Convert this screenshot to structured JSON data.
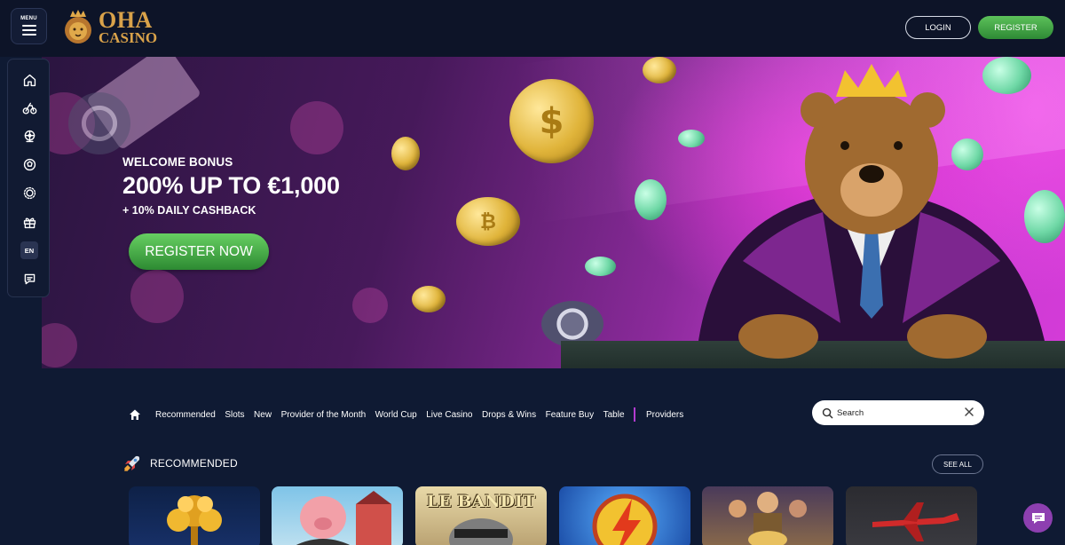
{
  "header": {
    "menu_label": "MENU",
    "logo_line1": "OHA",
    "logo_line2": "CASINO",
    "login_label": "LOGIN",
    "register_label": "REGISTER"
  },
  "sidebar": {
    "items": [
      "home-icon",
      "cycling-icon",
      "ferris-wheel-icon",
      "football-icon",
      "sun-icon",
      "gift-icon"
    ],
    "language": "EN",
    "support_icon": "chat-icon"
  },
  "banner": {
    "subtitle": "WELCOME BONUS",
    "title": "200% UP TO €1,000",
    "extra": "+ 10% DAILY CASHBACK",
    "cta_label": "REGISTER NOW"
  },
  "nav": {
    "items": [
      "Recommended",
      "Slots",
      "New",
      "Provider of the Month",
      "World Cup",
      "Live Casino",
      "Drops & Wins",
      "Feature Buy",
      "Table"
    ],
    "providers_label": "Providers"
  },
  "search": {
    "placeholder": "Search"
  },
  "recommended": {
    "title": "RECOMMENDED",
    "see_all_label": "SEE ALL",
    "games": [
      "",
      "",
      "LE BANDIT",
      "",
      "",
      ""
    ]
  },
  "colors": {
    "background": "#0f1a33",
    "accent_green": "#4cb24a",
    "accent_purple": "#b23bd0",
    "logo_gold": "#d9a24a"
  }
}
